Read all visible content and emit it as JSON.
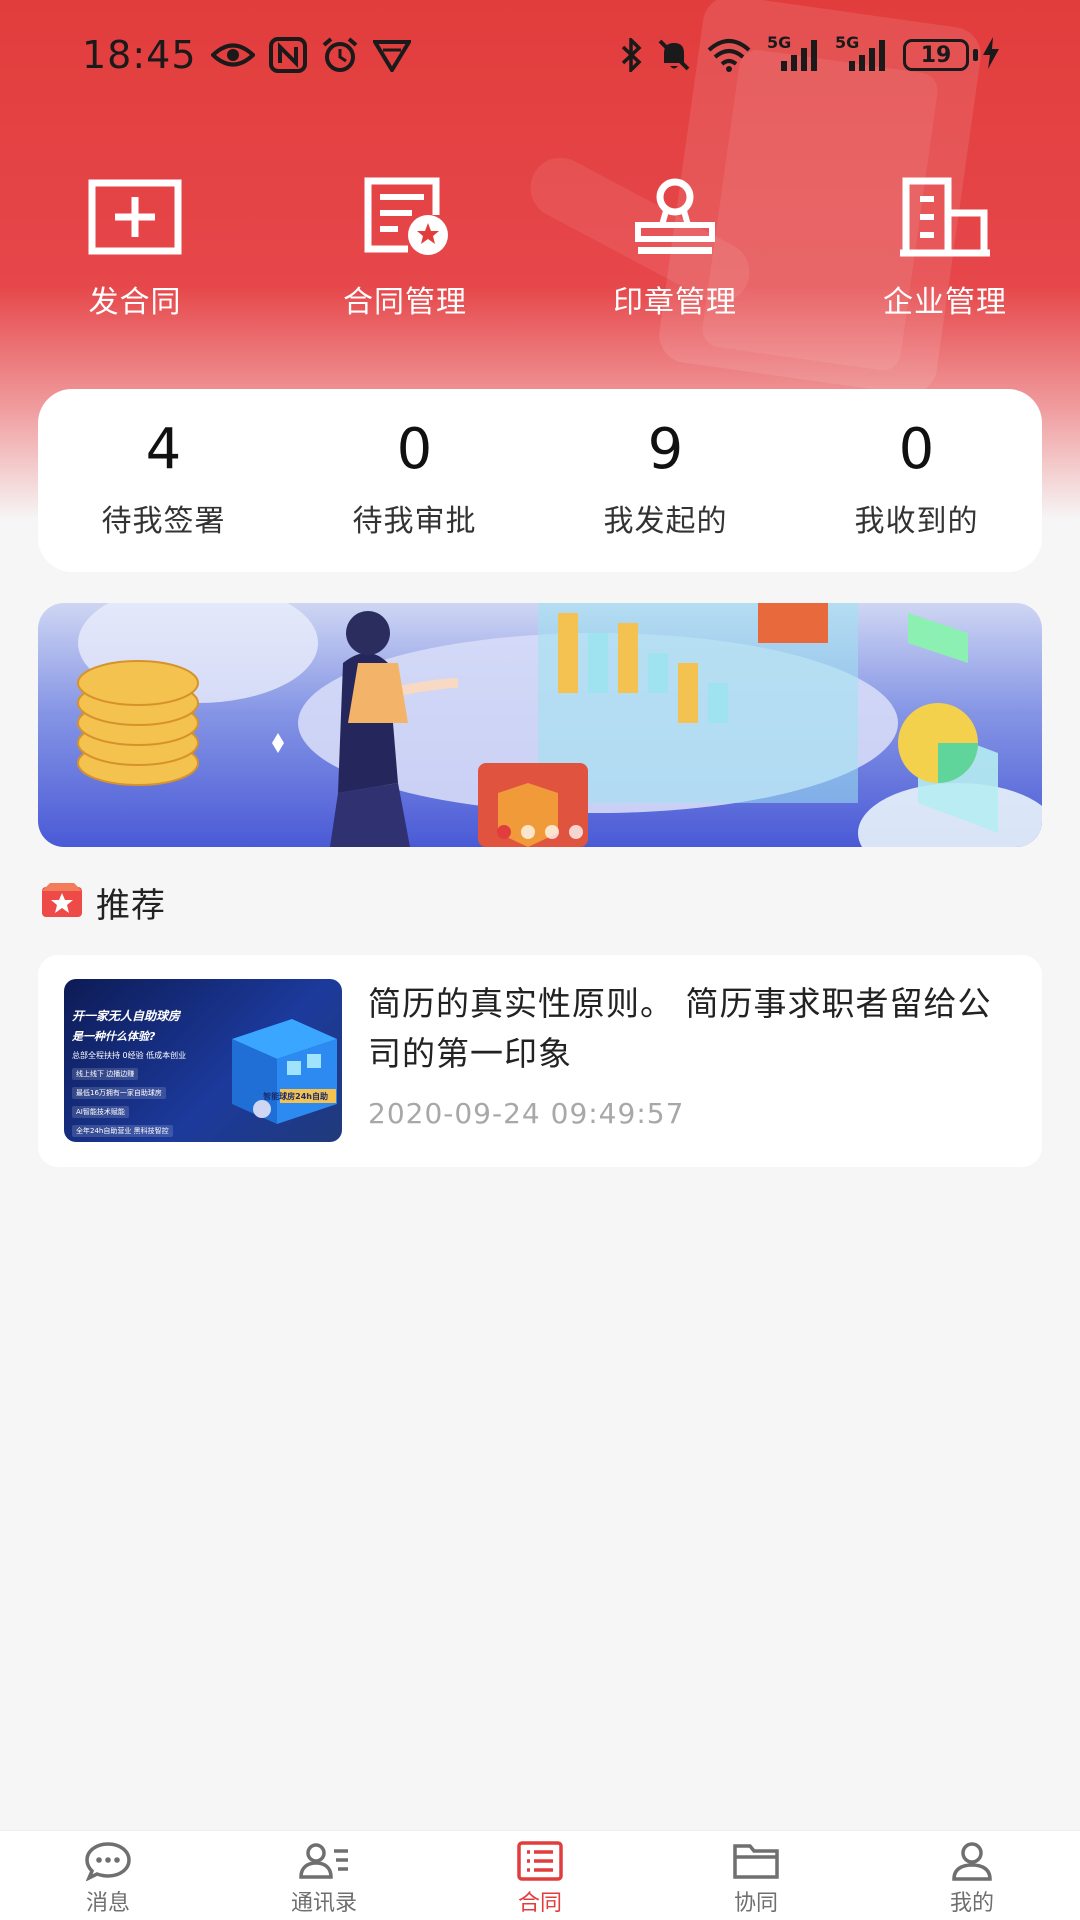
{
  "status_bar": {
    "time": "18:45",
    "battery": "19",
    "network_1": "5G",
    "network_2": "5G"
  },
  "quick_actions": [
    {
      "label": "发合同",
      "icon": "add-contract-icon"
    },
    {
      "label": "合同管理",
      "icon": "contract-management-icon"
    },
    {
      "label": "印章管理",
      "icon": "seal-icon"
    },
    {
      "label": "企业管理",
      "icon": "enterprise-icon"
    }
  ],
  "stats": [
    {
      "value": "4",
      "label": "待我签署"
    },
    {
      "value": "0",
      "label": "待我审批"
    },
    {
      "value": "9",
      "label": "我发起的"
    },
    {
      "value": "0",
      "label": "我收到的"
    }
  ],
  "banner": {
    "slide_count": 4,
    "active_slide": 1
  },
  "recommend": {
    "title": "推荐",
    "articles": [
      {
        "title": "简历的真实性原则。 简历事求职者留给公司的第一印象",
        "time": "2020-09-24 09:49:57",
        "thumb": {
          "line1": "开一家无人自助球房",
          "line2": "是一种什么体验?",
          "line3": "总部全程扶持 0经验 低成本创业",
          "chip1": "线上线下 边播边赚",
          "chip2": "最低16万拥有一家自助球房",
          "chip3": "AI智能技术赋能",
          "chip4": "全年24h自助营业 黑科技智控",
          "sign": "智能球房24h自助"
        }
      }
    ]
  },
  "colors": {
    "brand": "#e23d3d",
    "background": "#f6f6f6",
    "tab_inactive": "#6f6f6f"
  },
  "tab_bar": [
    {
      "label": "消息",
      "icon": "message-icon",
      "active": false
    },
    {
      "label": "通讯录",
      "icon": "contacts-icon",
      "active": false
    },
    {
      "label": "合同",
      "icon": "contract-icon",
      "active": true
    },
    {
      "label": "协同",
      "icon": "folder-icon",
      "active": false
    },
    {
      "label": "我的",
      "icon": "profile-icon",
      "active": false
    }
  ]
}
